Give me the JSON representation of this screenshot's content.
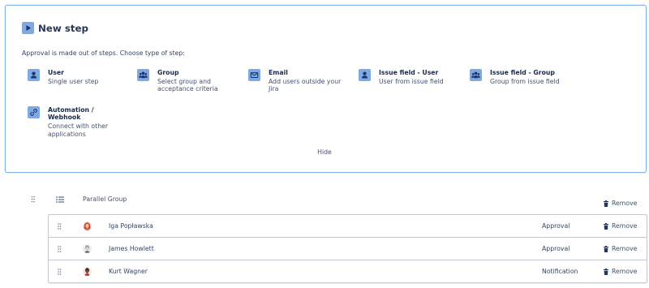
{
  "colors": {
    "panel_border": "#7fb1ec",
    "icon_background": "#7fa9e6",
    "icon_glyph": "#1d3461",
    "text_primary": "#172b4d",
    "text_secondary": "#42526e",
    "list_border": "#c4c9d1"
  },
  "new_step": {
    "title_icon": "play-icon",
    "title": "New step",
    "description": "Approval is made out of steps. Choose type of step:",
    "step_types": [
      {
        "icon": "user-icon",
        "title_lines": [
          "User"
        ],
        "desc_lines": [
          "Single user step"
        ]
      },
      {
        "icon": "group-icon",
        "title_lines": [
          "Group"
        ],
        "desc_lines": [
          "Select group and",
          "acceptance criteria"
        ]
      },
      {
        "icon": "email-icon",
        "title_lines": [
          "Email"
        ],
        "desc_lines": [
          "Add users outside your",
          "Jira"
        ]
      },
      {
        "icon": "user-icon",
        "title_lines": [
          "Issue field - User"
        ],
        "desc_lines": [
          "User from issue field"
        ]
      },
      {
        "icon": "group-icon",
        "title_lines": [
          "Issue field - Group"
        ],
        "desc_lines": [
          "Group from issue field"
        ]
      },
      {
        "icon": "link-icon",
        "title_lines": [
          "Automation /",
          "Webhook"
        ],
        "desc_lines": [
          "Connect with other",
          "applications"
        ]
      }
    ],
    "hide_label": "Hide"
  },
  "parallel_group": {
    "icon": "list-icon",
    "label": "Parallel Group",
    "remove_icon": "trash-icon",
    "remove_label": "Remove",
    "members": [
      {
        "name": "Iga Popławska",
        "type": "Approval",
        "remove_label": "Remove"
      },
      {
        "name": "James Howlett",
        "type": "Approval",
        "remove_label": "Remove"
      },
      {
        "name": "Kurt Wagner",
        "type": "Notification",
        "remove_label": "Remove"
      }
    ]
  }
}
